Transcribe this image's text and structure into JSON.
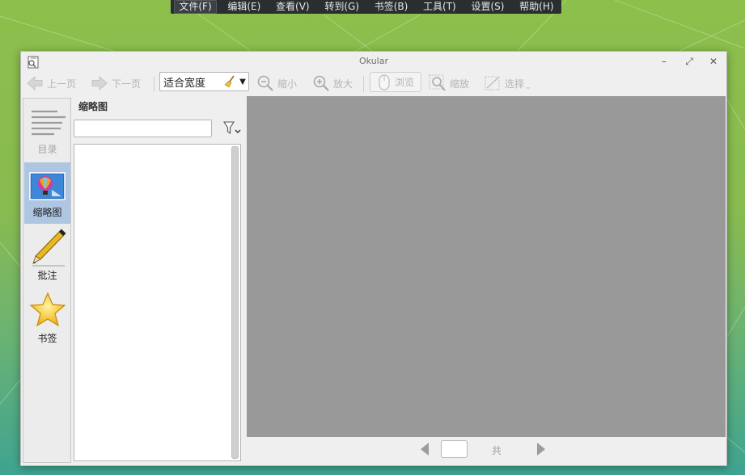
{
  "menubar": {
    "items": [
      "文件(F)",
      "编辑(E)",
      "查看(V)",
      "转到(G)",
      "书签(B)",
      "工具(T)",
      "设置(S)",
      "帮助(H)"
    ],
    "active_index": 0
  },
  "window": {
    "title": "Okular",
    "minimize_glyph": "–",
    "maximize_glyph": "⤢",
    "close_glyph": "✕"
  },
  "toolbar": {
    "prev_page_label": "上一页",
    "next_page_label": "下一页",
    "zoom_mode_value": "适合宽度",
    "zoom_out_label": "缩小",
    "zoom_in_label": "放大",
    "browse_label": "浏览",
    "zoom_tool_label": "缩放",
    "select_label": "选择"
  },
  "sidebar": {
    "tabs": [
      {
        "label": "目录",
        "icon": "contents-icon",
        "enabled": false
      },
      {
        "label": "缩略图",
        "icon": "thumbnails-icon",
        "selected": true
      },
      {
        "label": "批注",
        "icon": "pencil-icon"
      },
      {
        "label": "书签",
        "icon": "star-icon"
      }
    ]
  },
  "thumbnails": {
    "title": "缩略图",
    "search_value": "",
    "search_placeholder": ""
  },
  "bottom": {
    "page_value": "",
    "total_label": "共"
  },
  "colors": {
    "selected_tab": "#aec6e2",
    "document_area": "#999999",
    "menubar_bg": "#2b2e31"
  }
}
